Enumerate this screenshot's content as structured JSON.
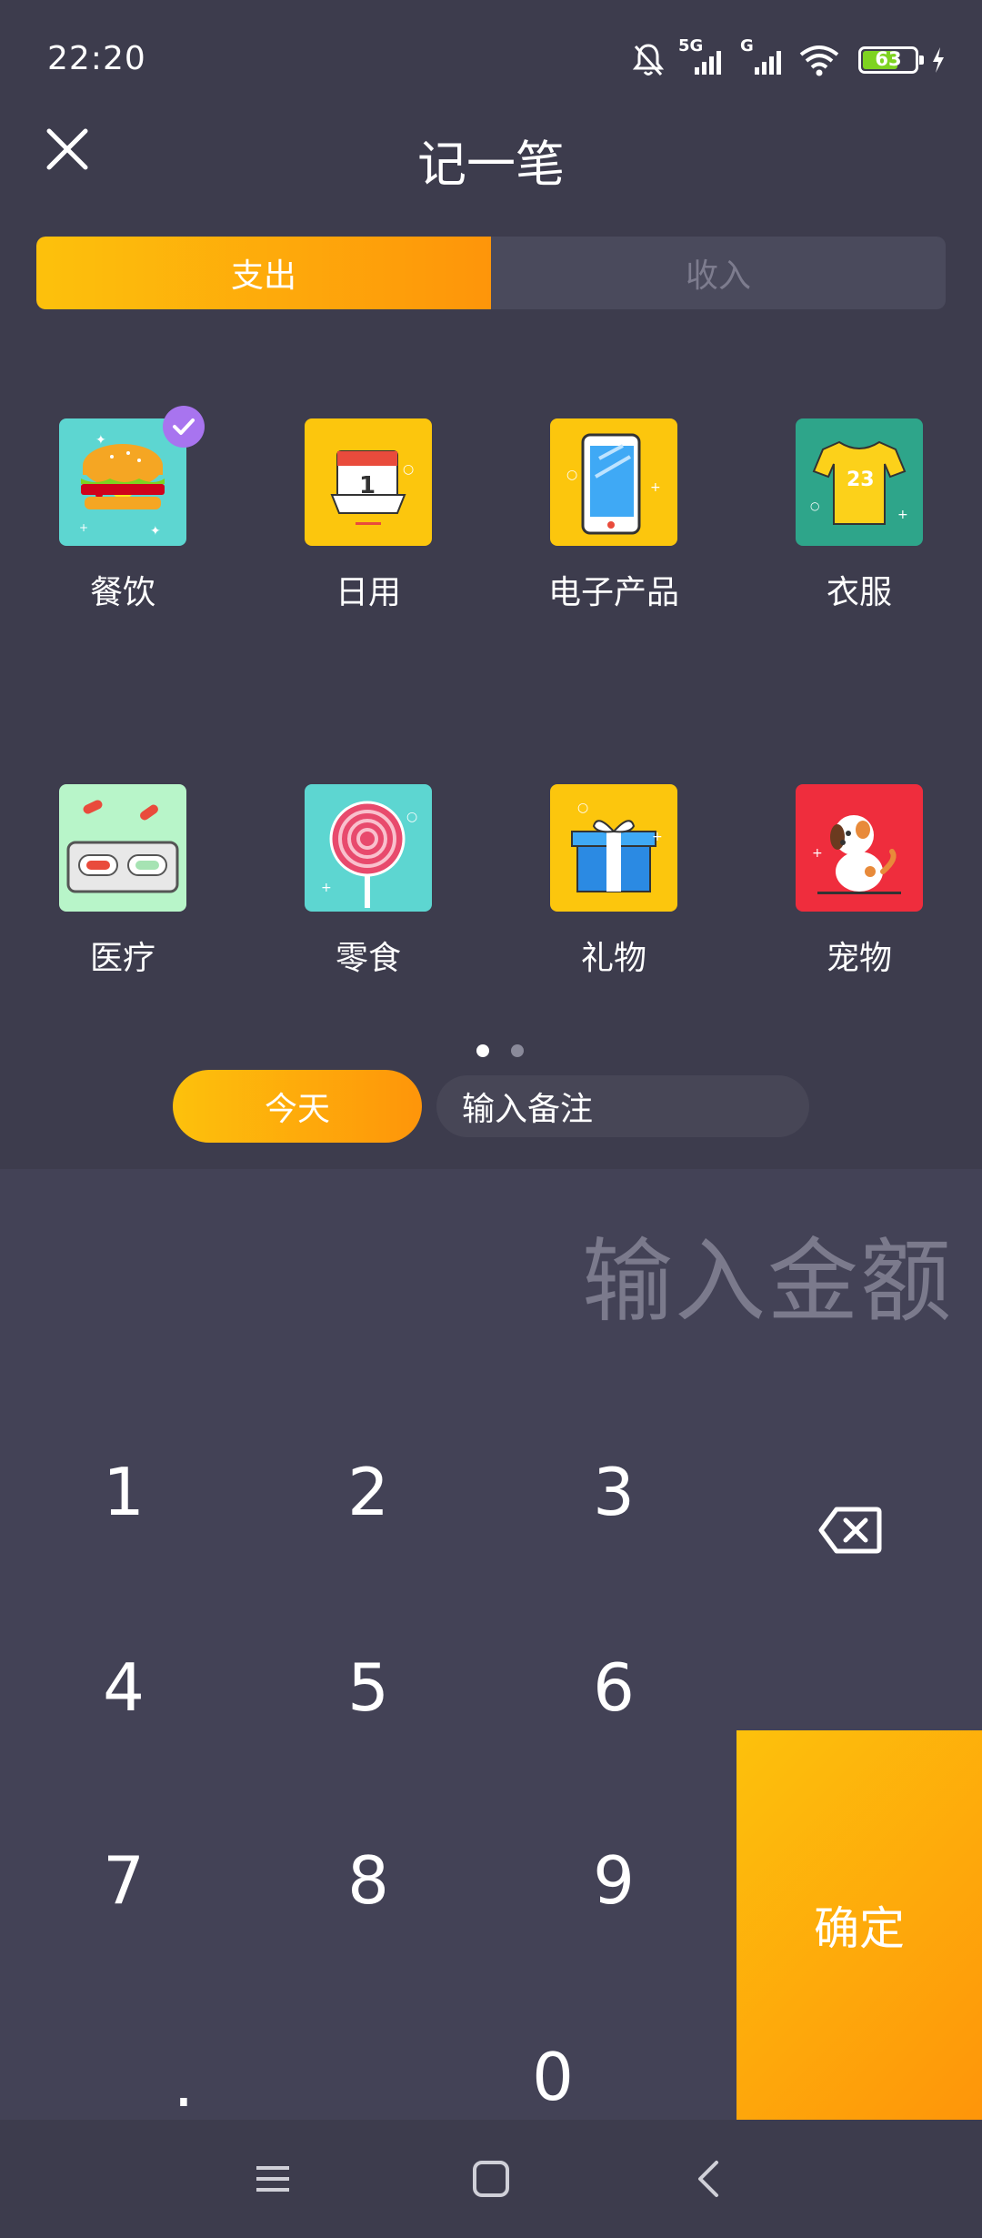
{
  "status": {
    "time": "22:20",
    "network": "5G",
    "network2": "G",
    "battery": "63"
  },
  "header": {
    "title": "记一笔"
  },
  "tabs": {
    "expense": "支出",
    "income": "收入"
  },
  "categories": [
    {
      "label": "餐饮",
      "icon": "burger-icon",
      "selected": true
    },
    {
      "label": "日用",
      "icon": "calendar-icon"
    },
    {
      "label": "电子产品",
      "icon": "phone-icon"
    },
    {
      "label": "衣服",
      "icon": "tshirt-icon",
      "number": "23"
    },
    {
      "label": "医疗",
      "icon": "pills-icon"
    },
    {
      "label": "零食",
      "icon": "lollipop-icon"
    },
    {
      "label": "礼物",
      "icon": "gift-icon"
    },
    {
      "label": "宠物",
      "icon": "dog-icon"
    }
  ],
  "entry": {
    "date_label": "今天",
    "note_placeholder": "输入备注",
    "amount_placeholder": "输入金额"
  },
  "keypad": {
    "keys": [
      "1",
      "2",
      "3",
      "4",
      "5",
      "6",
      "7",
      "8",
      "9",
      ".",
      "0"
    ],
    "confirm": "确定"
  },
  "colors": {
    "background": "#3d3c4d",
    "accent_start": "#fdc10c",
    "accent_end": "#fe950a",
    "check_badge": "#a874ef"
  }
}
